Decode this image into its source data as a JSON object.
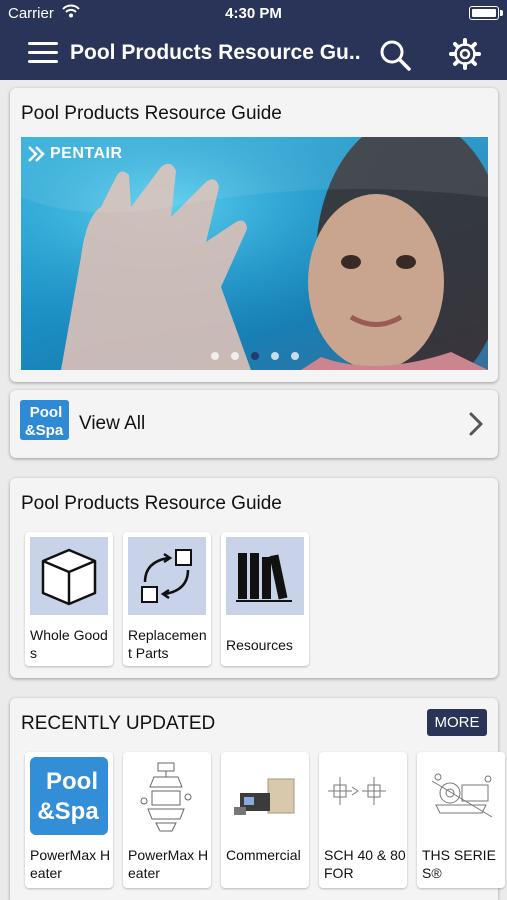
{
  "status_bar": {
    "carrier": "Carrier",
    "time": "4:30 PM"
  },
  "nav": {
    "title": "Pool Products Resource Gu..."
  },
  "hero": {
    "title": "Pool Products Resource Guide",
    "brand": "PENTAIR",
    "slide_count": 5,
    "active_slide": 3
  },
  "view_all": {
    "logo_text": [
      "Pool",
      "&Spa"
    ],
    "label": "View All"
  },
  "guide": {
    "title": "Pool Products Resource Guide",
    "tiles": [
      {
        "label": "Whole Goods",
        "icon": "box-icon"
      },
      {
        "label": "Replacement Parts",
        "icon": "swap-arrows-icon"
      },
      {
        "label": "Resources",
        "icon": "books-icon"
      }
    ]
  },
  "recent": {
    "title": "RECENTLY UPDATED",
    "more_label": "MORE",
    "items": [
      {
        "label": "PowerMax Heater",
        "thumb": "pool-spa-logo"
      },
      {
        "label": "PowerMax Heater",
        "thumb": "exploded-diagram"
      },
      {
        "label": "Commercial",
        "thumb": "controller-product"
      },
      {
        "label": "SCH 40 & 80 FOR",
        "thumb": "fittings-diagram"
      },
      {
        "label": "THS SERIES®",
        "thumb": "pump-diagram"
      }
    ]
  },
  "colors": {
    "navbar": "#2a3358",
    "tile_bg": "#c8d3ea",
    "accent": "#2a3358"
  }
}
